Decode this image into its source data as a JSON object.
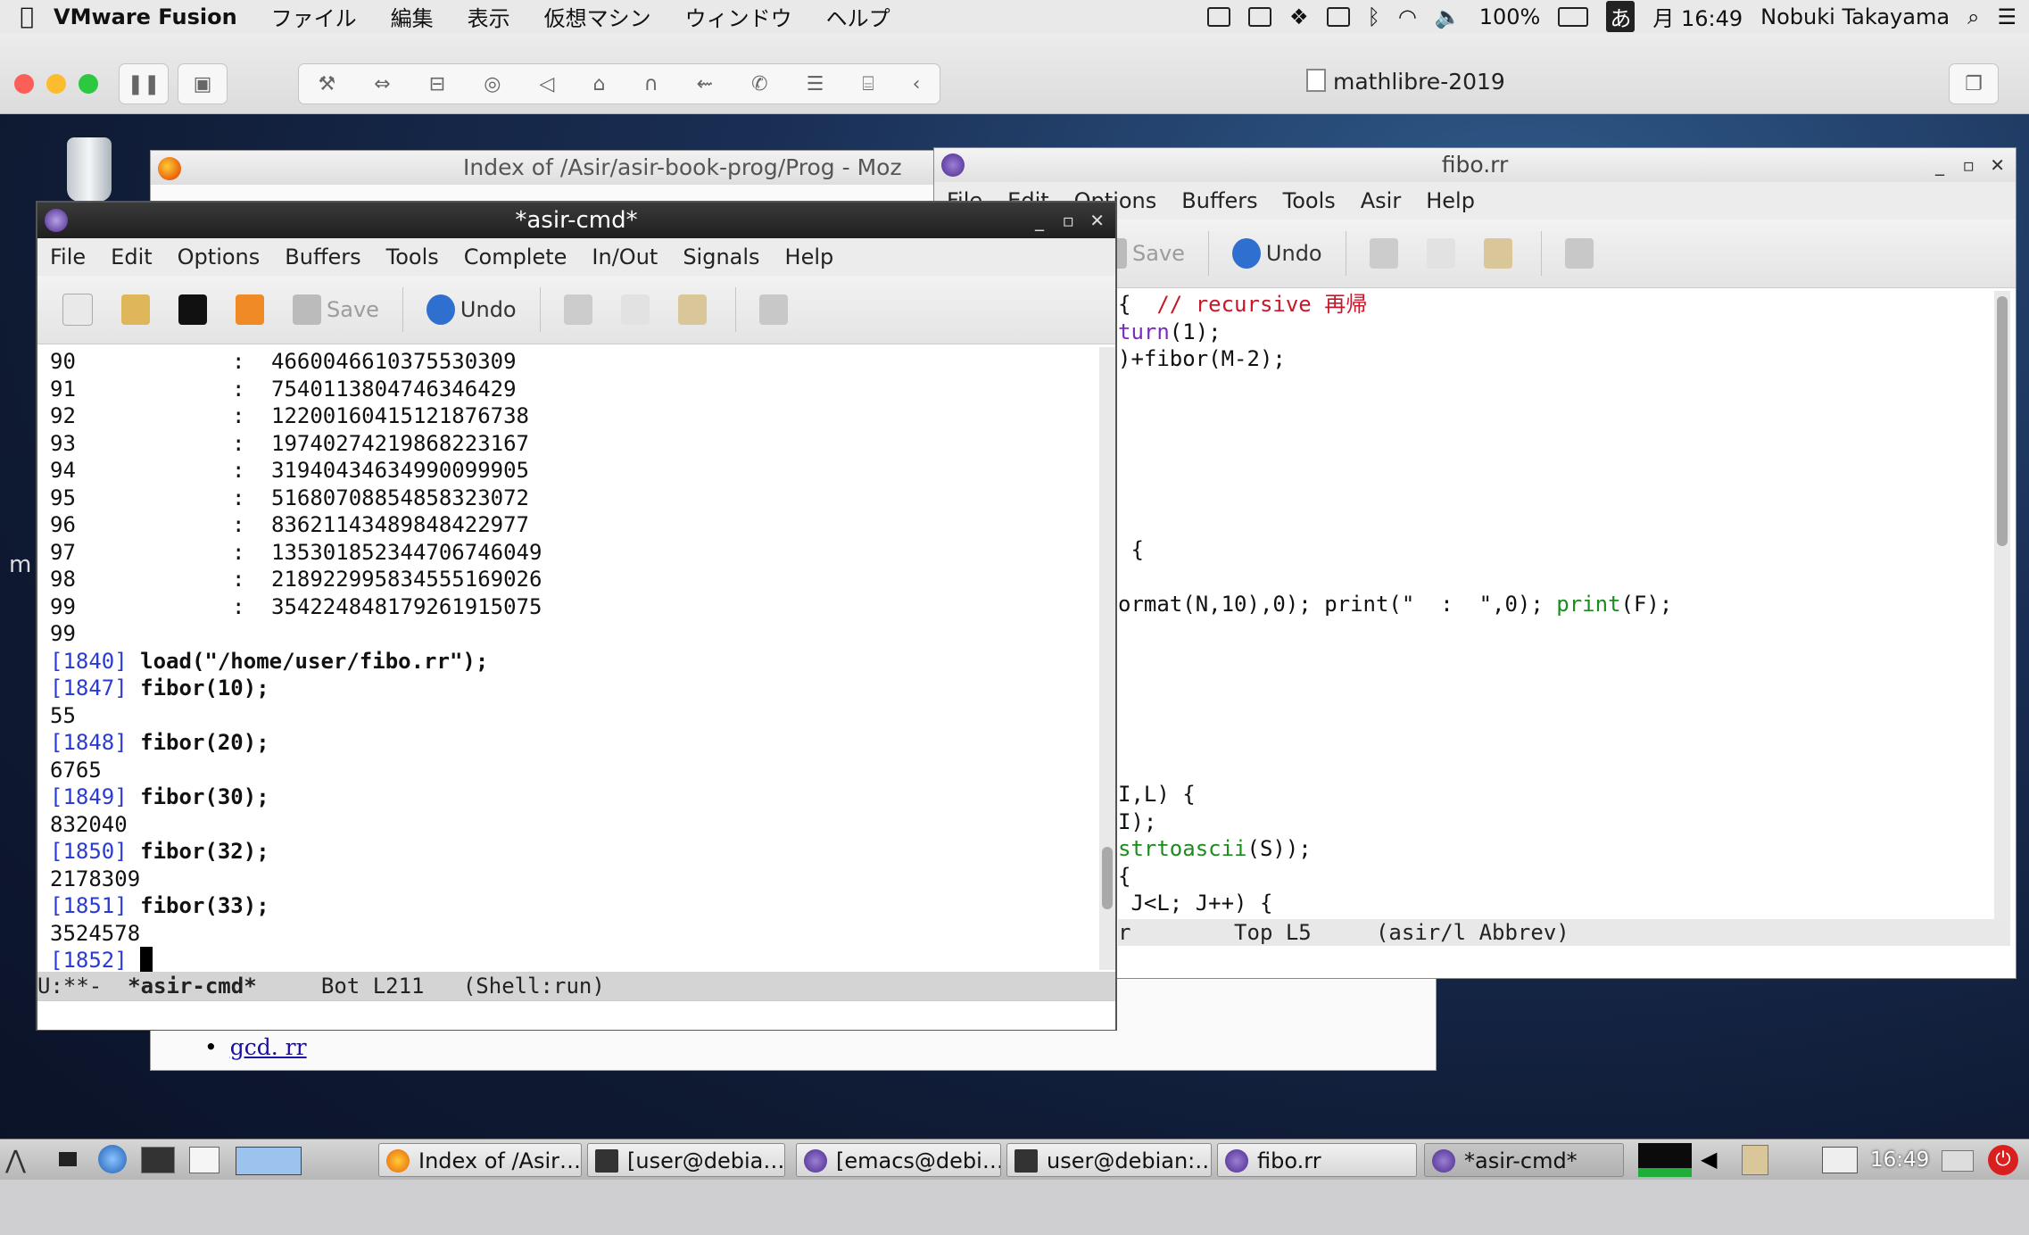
{
  "mac_menubar": {
    "app_name": "VMware Fusion",
    "menus": [
      "ファイル",
      "編集",
      "表示",
      "仮想マシン",
      "ウィンドウ",
      "ヘルプ"
    ],
    "battery": "100%",
    "ime": "あ",
    "clock": "月 16:49",
    "user": "Nobuki Takayama"
  },
  "vmware": {
    "title": "mathlibre-2019"
  },
  "firefox": {
    "title": "Index of /Asir/asir-book-prog/Prog - Moz",
    "link_text": "gcd. rr"
  },
  "fibo_window": {
    "title": "fibo.rr",
    "menus": [
      "File",
      "Edit",
      "Options",
      "Buffers",
      "Tools",
      "Asir",
      "Help"
    ],
    "toolbar": {
      "save": "Save",
      "undo": "Undo"
    },
    "code_lines": [
      "{  // recursive 再帰",
      "turn(1);",
      ")+fibor(M-2);",
      "",
      "",
      "",
      "",
      "",
      "",
      " {",
      "",
      "ormat(N,10),0); print(\"  :  \",0); print(F);",
      "",
      "",
      "",
      "",
      "",
      "",
      "I,L) {",
      "I);",
      "strtoascii(S));",
      "{",
      " J<L; J++) {"
    ],
    "mode_line": "r        Top L5     (asir/l Abbrev)"
  },
  "asir_window": {
    "title": "*asir-cmd*",
    "menus": [
      "File",
      "Edit",
      "Options",
      "Buffers",
      "Tools",
      "Complete",
      "In/Out",
      "Signals",
      "Help"
    ],
    "toolbar": {
      "save": "Save",
      "undo": "Undo"
    },
    "table_rows": [
      {
        "n": "90",
        "sep": ":",
        "v": "4660046610375530309"
      },
      {
        "n": "91",
        "sep": ":",
        "v": "7540113804746346429"
      },
      {
        "n": "92",
        "sep": ":",
        "v": "12200160415121876738"
      },
      {
        "n": "93",
        "sep": ":",
        "v": "19740274219868223167"
      },
      {
        "n": "94",
        "sep": ":",
        "v": "31940434634990099905"
      },
      {
        "n": "95",
        "sep": ":",
        "v": "51680708854858323072"
      },
      {
        "n": "96",
        "sep": ":",
        "v": "83621143489848422977"
      },
      {
        "n": "97",
        "sep": ":",
        "v": "135301852344706746049"
      },
      {
        "n": "98",
        "sep": ":",
        "v": "218922995834555169026"
      },
      {
        "n": "99",
        "sep": ":",
        "v": "354224848179261915075"
      }
    ],
    "after_table": "99",
    "session": [
      {
        "prompt": "[1840]",
        "cmd": "load(\"/home/user/fibo.rr\");",
        "out": ""
      },
      {
        "prompt": "[1847]",
        "cmd": "fibor(10);",
        "out": "55"
      },
      {
        "prompt": "[1848]",
        "cmd": "fibor(20);",
        "out": "6765"
      },
      {
        "prompt": "[1849]",
        "cmd": "fibor(30);",
        "out": "832040"
      },
      {
        "prompt": "[1850]",
        "cmd": "fibor(32);",
        "out": "2178309"
      },
      {
        "prompt": "[1851]",
        "cmd": "fibor(33);",
        "out": "3524578"
      }
    ],
    "current_prompt": "[1852]",
    "mode_line": {
      "status": "U:**-",
      "buffer": "*asir-cmd*",
      "position": "Bot L211",
      "mode": "(Shell:run)"
    }
  },
  "taskbar": {
    "tasks": [
      {
        "label": "Index of /Asir…",
        "icon": "firefox-icon"
      },
      {
        "label": "[user@debia…",
        "icon": "terminal-icon"
      },
      {
        "label": "[emacs@debi…",
        "icon": "emacs-icon"
      },
      {
        "label": "user@debian:…",
        "icon": "terminal-icon"
      },
      {
        "label": "fibo.rr",
        "icon": "emacs-icon"
      },
      {
        "label": "*asir-cmd*",
        "icon": "emacs-icon"
      }
    ],
    "clock": "16:49"
  },
  "colors": {
    "prompt": "#2a3bd1",
    "comment": "#c8172a",
    "builtin": "#1d8c1d"
  }
}
